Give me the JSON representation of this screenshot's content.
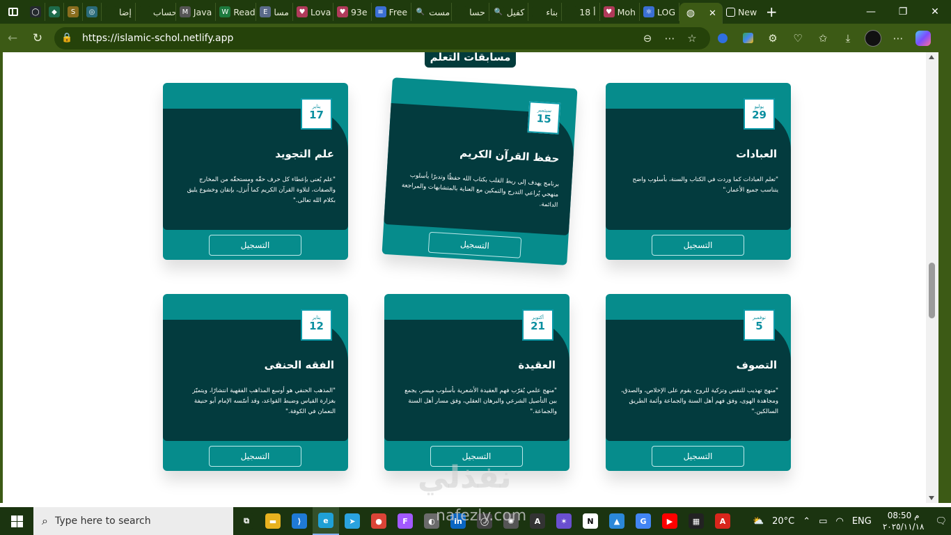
{
  "browser": {
    "tabs": [
      {
        "label": "",
        "fav_color": "#24292e",
        "fav_glyph": "◯"
      },
      {
        "label": "",
        "fav_color": "#1e6b4b",
        "fav_glyph": "◆"
      },
      {
        "label": "",
        "fav_color": "#8a6d1e",
        "fav_glyph": "S"
      },
      {
        "label": "",
        "fav_color": "#2a6b7a",
        "fav_glyph": "◎"
      },
      {
        "label": "إضا",
        "fav_color": "#1f3b0d",
        "fav_glyph": ""
      },
      {
        "label": "حساب",
        "fav_color": "#1f3b0d",
        "fav_glyph": ""
      },
      {
        "label": "Java",
        "fav_color": "#555",
        "fav_glyph": "M"
      },
      {
        "label": "Read",
        "fav_color": "#1d7a3e",
        "fav_glyph": "W"
      },
      {
        "label": "مسا",
        "fav_color": "#5a6a8a",
        "fav_glyph": "E"
      },
      {
        "label": "Lova",
        "fav_color": "#b03a5a",
        "fav_glyph": "♥"
      },
      {
        "label": "93e",
        "fav_color": "#b03a5a",
        "fav_glyph": "♥"
      },
      {
        "label": "Free",
        "fav_color": "#3b6fd4",
        "fav_glyph": "≡"
      },
      {
        "label": "مست",
        "fav_color": "#1f3b0d",
        "fav_glyph": "🔍"
      },
      {
        "label": "حسا",
        "fav_color": "#1f3b0d",
        "fav_glyph": ""
      },
      {
        "label": "كفيل",
        "fav_color": "#1f3b0d",
        "fav_glyph": "🔍"
      },
      {
        "label": "بناء",
        "fav_color": "#1f3b0d",
        "fav_glyph": ""
      },
      {
        "label": "18 أ",
        "fav_color": "#1f3b0d",
        "fav_glyph": ""
      },
      {
        "label": "Moh",
        "fav_color": "#b03a5a",
        "fav_glyph": "♥"
      },
      {
        "label": "LOG",
        "fav_color": "#3b6fd4",
        "fav_glyph": "⚛"
      }
    ],
    "active_tab_label": "",
    "new_tab_label": "New",
    "url": "https://islamic-schol.netlify.app"
  },
  "page": {
    "section_title": "مسابقات التعلم",
    "register_label": "التسجيل",
    "cards": [
      {
        "month": "يناير",
        "day": "17",
        "title": "علم التجويد",
        "desc": "\"علم يُعنى بإعطاء كل حرف حقّه ومستحقّه من المخارج والصفات، لتلاوة القرآن الكريم كما أُنزل، بإتقان وخشوع يليق بكلام الله تعالى.\""
      },
      {
        "month": "سبتمبر",
        "day": "15",
        "title": "حفظ القرآن الكريم",
        "desc": "برنامج يهدف إلى ربط القلب بكتاب الله حفظًا وتدبرًا بأسلوب منهجي يُراعي التدرج والتمكين مع العناية بالمتشابهات والمراجعة الدائمة."
      },
      {
        "month": "يوليو",
        "day": "29",
        "title": "العبادات",
        "desc": "\"تعلم العبادات كما وردت في الكتاب والسنة، بأسلوب واضح يتناسب جميع الأعمار.\""
      },
      {
        "month": "يناير",
        "day": "12",
        "title": "الفقه الحنفى",
        "desc": "\"المذهب الحنفي هو أوسع المذاهب الفقهية انتشارًا، ويتميّز بغزارة القياس وضبط القواعد، وقد أسّسه الإمام أبو حنيفة النعمان في الكوفة.\""
      },
      {
        "month": "أكتوبر",
        "day": "21",
        "title": "العقيدة",
        "desc": "\"منهج علمي يُقرّب فهم العقيدة الأشعرية بأسلوب ميسر، يجمع بين التأصيل الشرعي والبرهان العقلي، وفق مسار أهل السنة والجماعة.\""
      },
      {
        "month": "نوفمبر",
        "day": "5",
        "title": "التصوف",
        "desc": "\"منهج تهذيب للنفس وتزكية للروح، يقوم على الإخلاص، والصدق، ومجاهدة الهوى، وفق فهم أهل السنة والجماعة وأئمة الطريق السالكين.\""
      }
    ]
  },
  "watermark": {
    "line1": "نفذلي",
    "line2": "nafezly.com"
  },
  "taskbar": {
    "search_placeholder": "Type here to search",
    "weather": "20°C",
    "lang": "ENG",
    "time": "08:50 م",
    "date": "٢٠٢٥/١١/١٨",
    "apps": [
      {
        "name": "task-view",
        "color": "#1b3410",
        "glyph": "⧉"
      },
      {
        "name": "file-explorer",
        "color": "#e8b21f",
        "glyph": "▬"
      },
      {
        "name": "vscode",
        "color": "#1f7ad6",
        "glyph": "⟩"
      },
      {
        "name": "edge",
        "color": "#1fa0d6",
        "glyph": "e"
      },
      {
        "name": "telegram",
        "color": "#2aa3df",
        "glyph": "➤"
      },
      {
        "name": "chrome",
        "color": "#db4437",
        "glyph": "●"
      },
      {
        "name": "figma",
        "color": "#a259ff",
        "glyph": "F"
      },
      {
        "name": "photos",
        "color": "#6b6b6b",
        "glyph": "◐"
      },
      {
        "name": "linkedin",
        "color": "#0a66c2",
        "glyph": "in"
      },
      {
        "name": "github-desktop",
        "color": "#444",
        "glyph": "◯"
      },
      {
        "name": "chatgpt",
        "color": "#555",
        "glyph": "✺"
      },
      {
        "name": "app-a",
        "color": "#333",
        "glyph": "A"
      },
      {
        "name": "app-star",
        "color": "#6a4fd0",
        "glyph": "✶"
      },
      {
        "name": "notion",
        "color": "#fff",
        "glyph": "N"
      },
      {
        "name": "app-blue",
        "color": "#2b88d8",
        "glyph": "▲"
      },
      {
        "name": "google-translate",
        "color": "#4285f4",
        "glyph": "G"
      },
      {
        "name": "youtube",
        "color": "#ff0000",
        "glyph": "▶"
      },
      {
        "name": "calc-grid",
        "color": "#222",
        "glyph": "▦"
      },
      {
        "name": "acrobat",
        "color": "#d9261c",
        "glyph": "A"
      }
    ]
  }
}
